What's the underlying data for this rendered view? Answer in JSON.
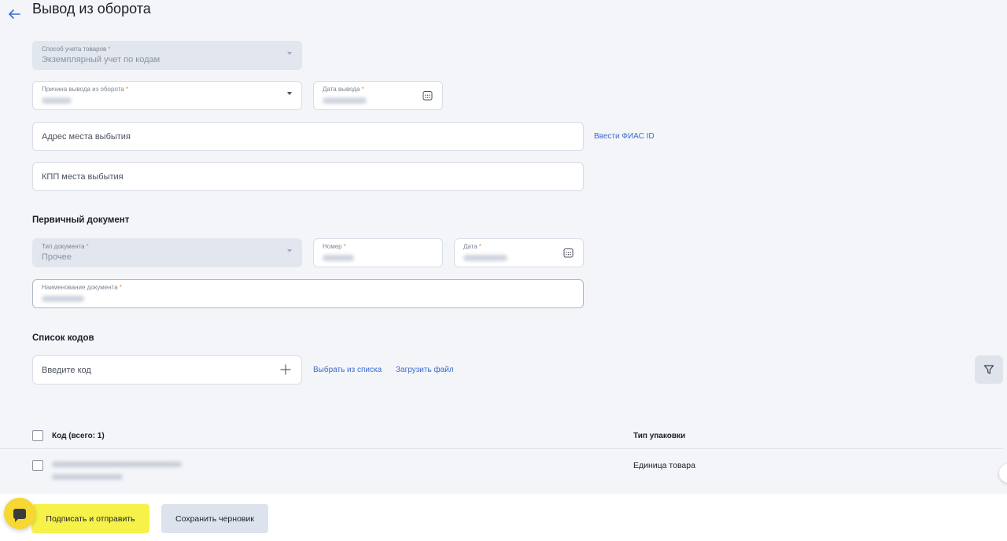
{
  "header": {
    "title": "Вывод из оборота"
  },
  "form": {
    "accounting_method": {
      "label": "Способ учета товаров",
      "value": "Экземплярный учет по кодам"
    },
    "withdrawal_reason": {
      "label": "Причина вывода из оборота"
    },
    "withdrawal_date": {
      "label": "Дата вывода"
    },
    "departure_address": {
      "placeholder": "Адрес места выбытия",
      "link": "Ввести ФИАС ID"
    },
    "departure_kpp": {
      "placeholder": "КПП места выбытия"
    }
  },
  "primary_document": {
    "title": "Первичный документ",
    "doc_type": {
      "label": "Тип документа",
      "value": "Прочее"
    },
    "number": {
      "label": "Номер"
    },
    "date": {
      "label": "Дата"
    },
    "name": {
      "label": "Наименование документа"
    }
  },
  "codes": {
    "title": "Список кодов",
    "input_placeholder": "Введите код",
    "choose_from_list": "Выбрать из списка",
    "upload_file": "Загрузить файл",
    "table": {
      "col_code": "Код (всего: 1)",
      "col_pack_type": "Тип упаковки",
      "rows": [
        {
          "pack_type": "Единица товара"
        }
      ]
    }
  },
  "footer": {
    "sign_send": "Подписать и отправить",
    "save_draft": "Сохранить черновик"
  },
  "colors": {
    "accent": "#3d6bd1",
    "primary_button": "#f6f24a",
    "chat_button": "#f7d731",
    "required_mark": "#f08a33"
  },
  "icons": [
    "arrow-left-icon",
    "chevron-down-icon",
    "calendar-icon",
    "plus-icon",
    "filter-icon",
    "chat-icon"
  ]
}
